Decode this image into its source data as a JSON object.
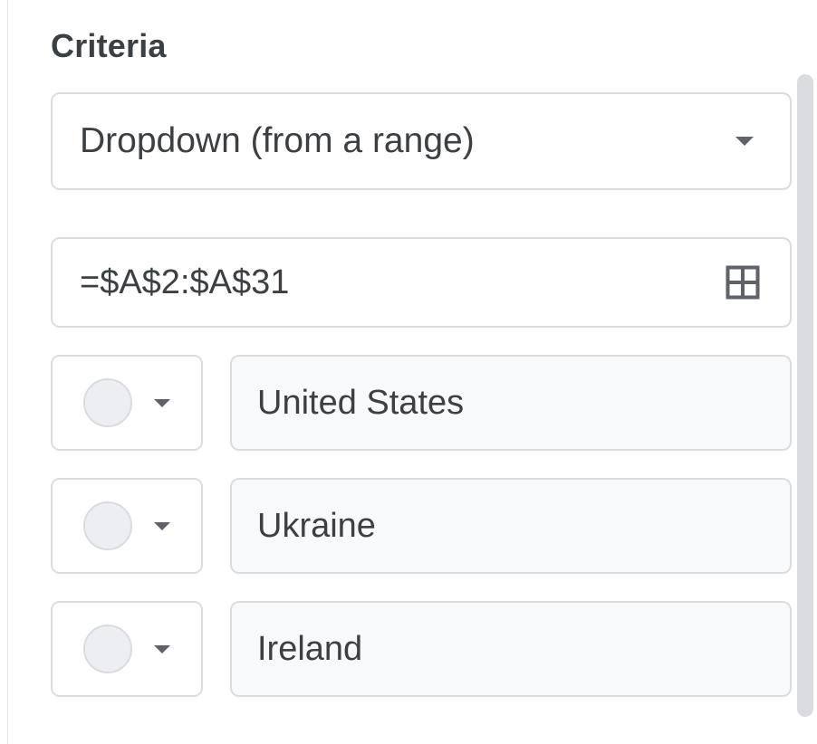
{
  "criteria": {
    "title": "Criteria",
    "dropdown_label": "Dropdown (from a range)",
    "range_value": "=$A$2:$A$31",
    "items": [
      {
        "label": "United States"
      },
      {
        "label": "Ukraine"
      },
      {
        "label": "Ireland"
      }
    ]
  }
}
